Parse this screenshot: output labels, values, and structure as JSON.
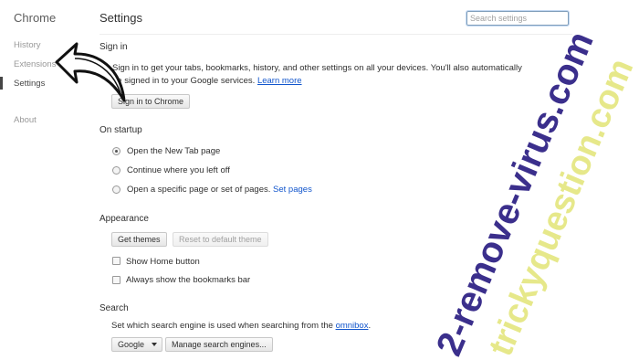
{
  "sidebar": {
    "brand": "Chrome",
    "items": [
      {
        "label": "History"
      },
      {
        "label": "Extensions"
      },
      {
        "label": "Settings"
      },
      {
        "label": "About"
      }
    ]
  },
  "header": {
    "title": "Settings",
    "search_placeholder": "Search settings"
  },
  "sign_in": {
    "title": "Sign in",
    "description_line1": "Sign in to get your tabs, bookmarks, history, and other settings on all your devices. You'll also automatically",
    "description_line2": "be signed in to your Google services.",
    "learn_more": "Learn more",
    "button": "Sign in to Chrome"
  },
  "on_startup": {
    "title": "On startup",
    "options": [
      {
        "label": "Open the New Tab page",
        "checked": true
      },
      {
        "label": "Continue where you left off",
        "checked": false
      },
      {
        "label": "Open a specific page or set of pages.",
        "checked": false
      }
    ],
    "set_pages_link": "Set pages"
  },
  "appearance": {
    "title": "Appearance",
    "get_themes": "Get themes",
    "reset_theme": "Reset to default theme",
    "checkboxes": [
      {
        "label": "Show Home button",
        "checked": false
      },
      {
        "label": "Always show the bookmarks bar",
        "checked": false
      }
    ]
  },
  "search": {
    "title": "Search",
    "description": "Set which search engine is used when searching from the",
    "omnibox_link": "omnibox",
    "description_end": ".",
    "engine": "Google",
    "manage_button": "Manage search engines..."
  },
  "watermark": {
    "line1": "2-remove-virus.com",
    "line2": "trickyquestion.com",
    "color1": "#3b2f8c",
    "color2": "#e6e88a"
  },
  "colors": {
    "link": "#1155cc",
    "text": "#303030",
    "muted": "#999999"
  }
}
